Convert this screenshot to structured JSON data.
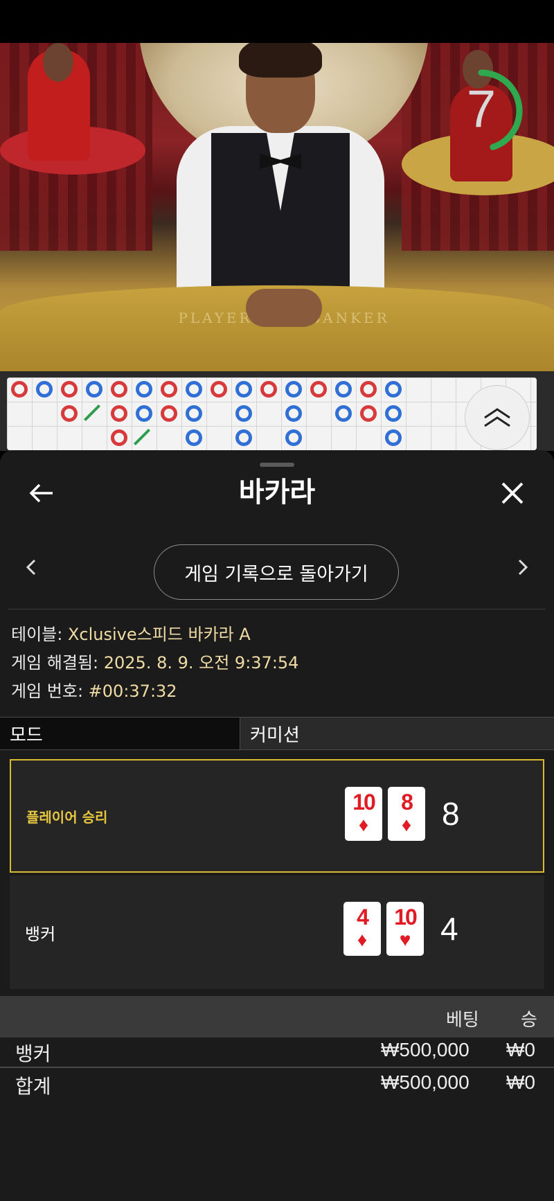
{
  "timer": {
    "value": "7",
    "fraction_remaining": 0.45,
    "color": "#2fa84f"
  },
  "table_felt": {
    "left": "PLAYER",
    "right": "BANKER"
  },
  "roadmap": {
    "beads": [
      [
        "r",
        "b",
        "r",
        "b",
        "r",
        "b",
        "r",
        "b",
        "r",
        "b",
        "r",
        "b",
        "r",
        "b",
        "r",
        "b"
      ],
      [
        "",
        "",
        "r",
        "t",
        "r",
        "b",
        "r",
        "b",
        "",
        "b",
        "",
        "b",
        "",
        "b",
        "r",
        "b"
      ],
      [
        "",
        "",
        "",
        "",
        "r",
        "t",
        "",
        "b",
        "",
        "b",
        "",
        "b",
        "",
        "",
        "",
        "b"
      ]
    ]
  },
  "panel": {
    "title": "바카라",
    "history_button": "게임 기록으로 돌아가기",
    "info": {
      "table_label": "테이블: ",
      "table_value": "Xclusive스피드 바카라 A",
      "resolved_label": "게임 해결됨: ",
      "resolved_value": "2025. 8. 9. 오전 9:37:54",
      "number_label": "게임 번호: ",
      "number_value": "#00:37:32"
    },
    "tabs": {
      "mode": "모드",
      "commission": "커미션"
    },
    "results": [
      {
        "label": "플레이어 승리",
        "cards": [
          {
            "rank": "10",
            "suit": "♦"
          },
          {
            "rank": "8",
            "suit": "♦"
          }
        ],
        "score": "8",
        "winner": true
      },
      {
        "label": "뱅커",
        "cards": [
          {
            "rank": "4",
            "suit": "♦"
          },
          {
            "rank": "10",
            "suit": "♥"
          }
        ],
        "score": "4",
        "winner": false
      }
    ],
    "bets": {
      "header_bet": "베팅",
      "header_win": "승",
      "rows": [
        {
          "name": "뱅커",
          "bet": "₩500,000",
          "win": "₩0"
        },
        {
          "name": "합계",
          "bet": "₩500,000",
          "win": "₩0"
        }
      ]
    }
  },
  "colors": {
    "win_border": "#d8bb2e",
    "win_text": "#e7c740",
    "info_value": "#f0dca4",
    "card_red": "#e01b24"
  }
}
